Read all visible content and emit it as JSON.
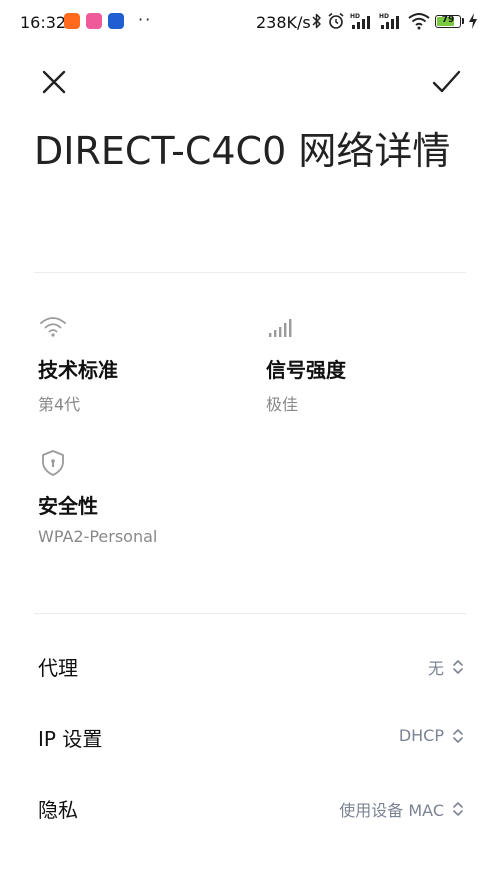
{
  "status_bar": {
    "time": "16:32",
    "more": "··",
    "net_speed": "238K/s",
    "hd1": "HD",
    "hd2": "HD",
    "battery": "79",
    "icons": [
      "mi-app-icon",
      "game-app-icon",
      "blue-app-icon",
      "bluetooth-icon",
      "alarm-icon",
      "signal-hd-icon",
      "signal-hd-icon",
      "wifi-icon",
      "battery-icon",
      "charging-icon"
    ],
    "colors": {
      "mi_app": "#ff6a1f",
      "game_app": "#ef5a9b",
      "blue_app": "#1f5fd1",
      "battery_fill": "#7ac943"
    }
  },
  "toolbar": {
    "close_icon": "close-icon",
    "confirm_icon": "check-icon"
  },
  "title": "DIRECT-C4C0 网络详情",
  "info": {
    "standard": {
      "icon": "wifi-icon",
      "label": "技术标准",
      "value": "第4代"
    },
    "signal": {
      "icon": "signal-strength-icon",
      "label": "信号强度",
      "value": "极佳"
    },
    "security": {
      "icon": "shield-icon",
      "label": "安全性",
      "value": "WPA2-Personal"
    }
  },
  "settings": [
    {
      "label": "代理",
      "value": "无"
    },
    {
      "label": "IP 设置",
      "value": "DHCP"
    },
    {
      "label": "隐私",
      "value": "使用设备 MAC"
    }
  ]
}
